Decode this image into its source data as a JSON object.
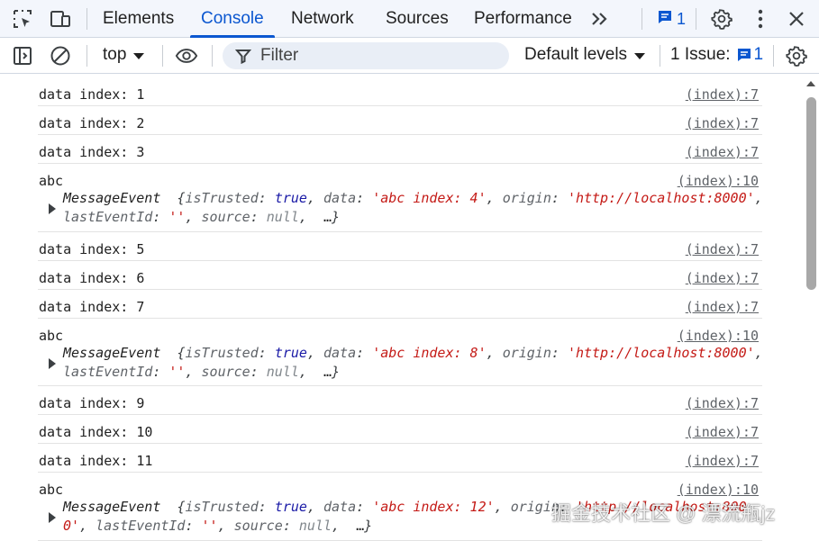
{
  "tabbar": {
    "tabs": [
      "Elements",
      "Console",
      "Network",
      "Sources",
      "Performance"
    ],
    "active_tab": "Console",
    "more_tabs_glyph": "»",
    "messages_count": "1",
    "icons": [
      "inspect-element-icon",
      "device-toolbar-icon",
      "chevron-double-right-icon",
      "message-icon",
      "gear-icon",
      "kebab-menu-icon",
      "close-icon"
    ]
  },
  "toolbar": {
    "context": "top",
    "filter_placeholder": "Filter",
    "levels": "Default levels",
    "issues_label": "1 Issue:",
    "issues_count": "1",
    "icons": [
      "sidebar-toggle-icon",
      "clear-console-icon",
      "eye-icon",
      "filter-icon",
      "gear-icon"
    ]
  },
  "console": {
    "rows": [
      {
        "kind": "log",
        "text": "data index: 1",
        "source": "(index):7"
      },
      {
        "kind": "log",
        "text": "data index: 2",
        "source": "(index):7"
      },
      {
        "kind": "log",
        "text": "data index: 3",
        "source": "(index):7"
      },
      {
        "kind": "event",
        "text": "abc",
        "source": "(index):10",
        "object": {
          "type": "MessageEvent",
          "isTrusted": "true",
          "data": "'abc index: 4'",
          "origin": "'http://localhost:8000'",
          "lastEventId": "''",
          "source": "null",
          "ellipsis": "…"
        }
      },
      {
        "kind": "log",
        "text": "data index: 5",
        "source": "(index):7"
      },
      {
        "kind": "log",
        "text": "data index: 6",
        "source": "(index):7"
      },
      {
        "kind": "log",
        "text": "data index: 7",
        "source": "(index):7"
      },
      {
        "kind": "event",
        "text": "abc",
        "source": "(index):10",
        "object": {
          "type": "MessageEvent",
          "isTrusted": "true",
          "data": "'abc index: 8'",
          "origin": "'http://localhost:8000'",
          "lastEventId": "''",
          "source": "null",
          "ellipsis": "…"
        }
      },
      {
        "kind": "log",
        "text": "data index: 9",
        "source": "(index):7"
      },
      {
        "kind": "log",
        "text": "data index: 10",
        "source": "(index):7"
      },
      {
        "kind": "log",
        "text": "data index: 11",
        "source": "(index):7"
      },
      {
        "kind": "event",
        "text": "abc",
        "source": "(index):10",
        "object": {
          "type": "MessageEvent",
          "isTrusted": "true",
          "data": "'abc index: 12'",
          "origin": "'http://localhost:800",
          "origin_wrap": "0'",
          "lastEventId": "''",
          "source": "null",
          "ellipsis": "…"
        }
      }
    ]
  },
  "watermark": "掘金技术社区 @ 漂流瓶jz",
  "colors": {
    "accent": "#0b57d0",
    "tabbar_bg": "#f3f6fc",
    "filter_bg": "#e9eef6",
    "string": "#c41a16",
    "boolean": "#1a1aa6",
    "muted": "#5f6368"
  }
}
